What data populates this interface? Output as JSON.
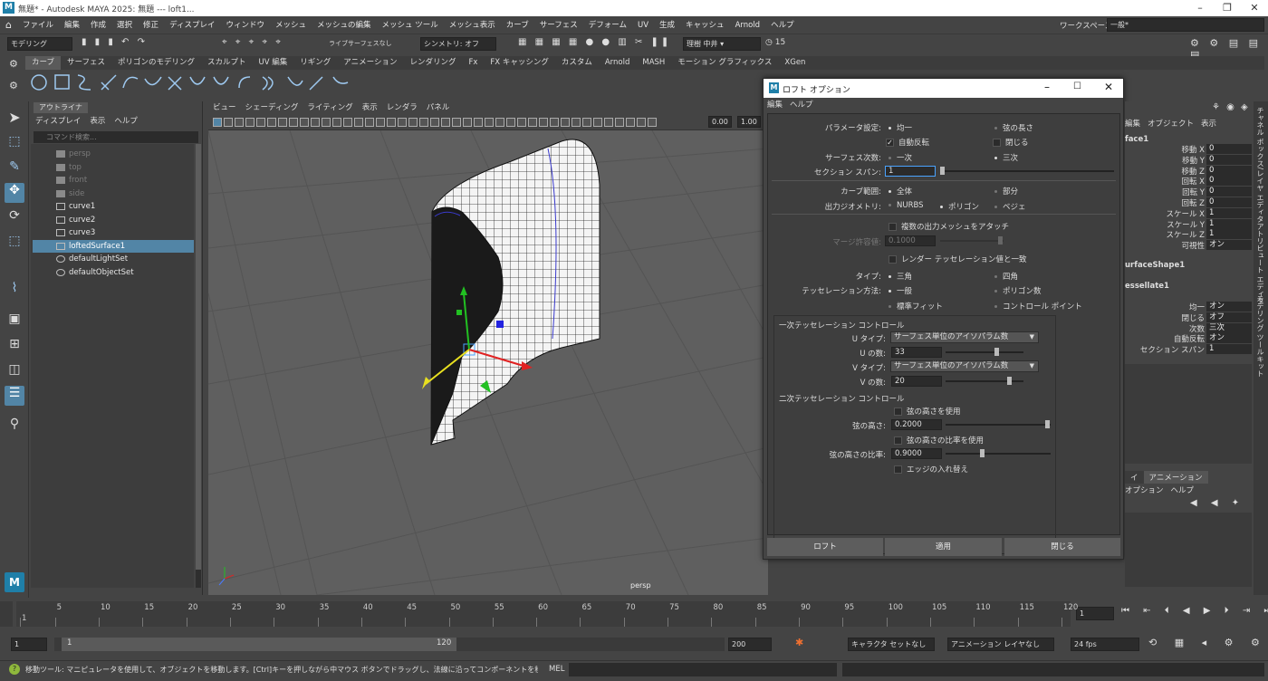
{
  "app": {
    "title": "無題* - Autodesk MAYA 2025: 無題   ---   loft1..."
  },
  "menubar": [
    "ファイル",
    "編集",
    "作成",
    "選択",
    "修正",
    "ディスプレイ",
    "ウィンドウ",
    "メッシュ",
    "メッシュの編集",
    "メッシュ ツール",
    "メッシュ表示",
    "カーブ",
    "サーフェス",
    "デフォーム",
    "UV",
    "生成",
    "キャッシュ",
    "Arnold",
    "ヘルプ"
  ],
  "workspace": {
    "label": "ワークスペース:",
    "value": "一般*"
  },
  "statusline": {
    "mode": "モデリング",
    "live": "ライブ",
    "live_value": "サーフェスなし",
    "symmetry": "シンメトリ: オフ",
    "user": "理樹 中井",
    "notif": "15"
  },
  "shelf_tabs": [
    "カーブ",
    "サーフェス",
    "ポリゴンのモデリング",
    "スカルプト",
    "UV 編集",
    "リギング",
    "アニメーション",
    "レンダリング",
    "Fx",
    "FX キャッシング",
    "カスタム",
    "Arnold",
    "MASH",
    "モーション グラフィックス",
    "XGen"
  ],
  "outliner": {
    "tab": "アウトライナ",
    "menu": [
      "ディスプレイ",
      "表示",
      "ヘルプ"
    ],
    "search_placeholder": "コマンド検索...",
    "items": [
      {
        "label": "persp",
        "dim": true
      },
      {
        "label": "top",
        "dim": true
      },
      {
        "label": "front",
        "dim": true
      },
      {
        "label": "side",
        "dim": true
      },
      {
        "label": "curve1",
        "dim": false
      },
      {
        "label": "curve2",
        "dim": false
      },
      {
        "label": "curve3",
        "dim": false
      },
      {
        "label": "loftedSurface1",
        "dim": false,
        "selected": true
      },
      {
        "label": "defaultLightSet",
        "dim": false
      },
      {
        "label": "defaultObjectSet",
        "dim": false
      }
    ]
  },
  "viewport": {
    "menu": [
      "ビュー",
      "シェーディング",
      "ライティング",
      "表示",
      "レンダラ",
      "パネル"
    ],
    "val1": "0.00",
    "val2": "1.00",
    "camera": "persp"
  },
  "dialog": {
    "title": "ロフト オプション",
    "menu": [
      "編集",
      "ヘルプ"
    ],
    "param_label": "パラメータ設定:",
    "param_opt1": "均一",
    "param_opt2": "弦の長さ",
    "auto_reverse": "自動反転",
    "close": "閉じる",
    "degree_label": "サーフェス次数:",
    "degree_opt1": "一次",
    "degree_opt2": "三次",
    "span_label": "セクション スパン:",
    "span_value": "1",
    "curve_range_label": "カーブ範囲:",
    "curve_range_opt1": "全体",
    "curve_range_opt2": "部分",
    "out_geom_label": "出力ジオメトリ:",
    "out_geom_opt1": "NURBS",
    "out_geom_opt2": "ポリゴン",
    "out_geom_opt3": "ベジェ",
    "attach_multi": "複数の出力メッシュをアタッチ",
    "merge_tol_label": "マージ許容値:",
    "merge_tol_value": "0.1000",
    "match_render": "レンダー テッセレーション値と一致",
    "type_label": "タイプ:",
    "type_opt1": "三角",
    "type_opt2": "四角",
    "tess_label": "テッセレーション方法:",
    "tess_opt1": "一般",
    "tess_opt2": "ポリゴン数",
    "tess_opt3": "標準フィット",
    "tess_opt4": "コントロール ポイント",
    "primary_section": "一次テッセレーション コントロール",
    "u_type_label": "U タイプ:",
    "u_type_value": "サーフェス単位のアイソパラム数",
    "u_count_label": "U の数:",
    "u_count_value": "33",
    "v_type_label": "V タイプ:",
    "v_type_value": "サーフェス単位のアイソパラム数",
    "v_count_label": "V の数:",
    "v_count_value": "20",
    "secondary_section": "二次テッセレーション コントロール",
    "use_chord_height": "弦の高さを使用",
    "chord_height_label": "弦の高さ:",
    "chord_height_value": "0.2000",
    "use_chord_ratio": "弦の高さの比率を使用",
    "chord_ratio_label": "弦の高さの比率:",
    "chord_ratio_value": "0.9000",
    "edge_swap": "エッジの入れ替え",
    "btn_loft": "ロフト",
    "btn_apply": "適用",
    "btn_close": "閉じる"
  },
  "channelbox": {
    "menu": [
      "編集",
      "オブジェクト",
      "表示"
    ],
    "object": "face1",
    "rows": [
      {
        "k": "移動 X",
        "v": "0"
      },
      {
        "k": "移動 Y",
        "v": "0"
      },
      {
        "k": "移動 Z",
        "v": "0"
      },
      {
        "k": "回転 X",
        "v": "0"
      },
      {
        "k": "回転 Y",
        "v": "0"
      },
      {
        "k": "回転 Z",
        "v": "0"
      },
      {
        "k": "スケール X",
        "v": "1"
      },
      {
        "k": "スケール Y",
        "v": "1"
      },
      {
        "k": "スケール Z",
        "v": "1"
      },
      {
        "k": "可視性",
        "v": "オン"
      }
    ],
    "shape": "urfaceShape1",
    "tess": "essellate1",
    "tess_rows": [
      {
        "k": "均一",
        "v": "オン"
      },
      {
        "k": "閉じる",
        "v": "オフ"
      },
      {
        "k": "次数",
        "v": "三次"
      },
      {
        "k": "自動反転",
        "v": "オン"
      },
      {
        "k": "セクション スパン",
        "v": "1"
      }
    ],
    "lower_tabs": [
      "イ",
      "アニメーション"
    ],
    "lower_menu": [
      "オプション",
      "ヘルプ"
    ],
    "side_tabs": [
      "チャネル ボックス/レイヤ エディタ",
      "アトリビュート エディタ",
      "モデリング ツールキット"
    ]
  },
  "timeline": {
    "ticks": [
      "1",
      "5",
      "10",
      "15",
      "20",
      "25",
      "30",
      "35",
      "40",
      "45",
      "50",
      "55",
      "60",
      "65",
      "70",
      "75",
      "80",
      "85",
      "90",
      "95",
      "100",
      "105",
      "110",
      "115",
      "120"
    ],
    "current": "1"
  },
  "range": {
    "start": "1",
    "inner_start": "1",
    "inner_end": "120",
    "end": "200",
    "char_set": "キャラクタ セットなし",
    "anim_layer": "アニメーション レイヤなし",
    "fps": "24 fps"
  },
  "cmdline": {
    "help": "移動ツール: マニピュレータを使用して、オブジェクトを移動します。[Ctrl]キーを押しながら中マウス ボタンでドラッグし、法線に沿ってコンポーネントを移動します。[Shift]キーを押しながらマニピ",
    "mel": "MEL"
  },
  "colors": {
    "accent": "#5285a6",
    "bg": "#444444",
    "viewport": "#5f5f5f",
    "maya": "#1f7fa8"
  }
}
